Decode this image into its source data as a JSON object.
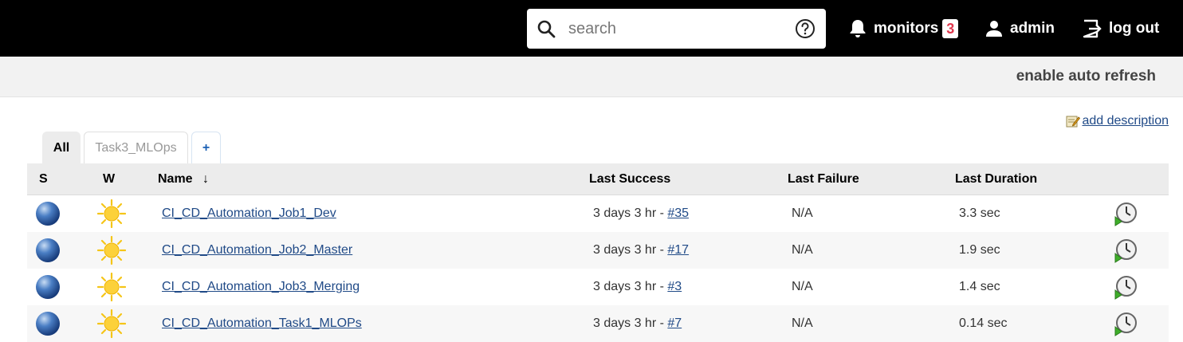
{
  "header": {
    "search_placeholder": "search",
    "monitors_label": "monitors",
    "monitors_count": "3",
    "user_label": "admin",
    "logout_label": "log out"
  },
  "subbar": {
    "auto_refresh": "enable auto refresh",
    "add_description": "add description"
  },
  "tabs": [
    {
      "label": "All",
      "active": true
    },
    {
      "label": "Task3_MLOps",
      "active": false
    },
    {
      "label": "+",
      "active": false
    }
  ],
  "table": {
    "columns": [
      "S",
      "W",
      "Name",
      "Last Success",
      "Last Failure",
      "Last Duration"
    ],
    "sort_indicator": "↓",
    "rows": [
      {
        "name": "CI_CD_Automation_Job1_Dev",
        "success_prefix": "3 days 3 hr - ",
        "success_build": "#35",
        "failure": "N/A",
        "duration": "3.3 sec"
      },
      {
        "name": "CI_CD_Automation_Job2_Master",
        "success_prefix": "3 days 3 hr - ",
        "success_build": "#17",
        "failure": "N/A",
        "duration": "1.9 sec"
      },
      {
        "name": "CI_CD_Automation_Job3_Merging",
        "success_prefix": "3 days 3 hr - ",
        "success_build": "#3",
        "failure": "N/A",
        "duration": "1.4 sec"
      },
      {
        "name": "CI_CD_Automation_Task1_MLOPs",
        "success_prefix": "3 days 3 hr - ",
        "success_build": "#7",
        "failure": "N/A",
        "duration": "0.14 sec"
      }
    ]
  },
  "icons": {
    "status": "blue-ball-icon",
    "weather": "sun-icon",
    "build": "schedule-build-icon"
  }
}
